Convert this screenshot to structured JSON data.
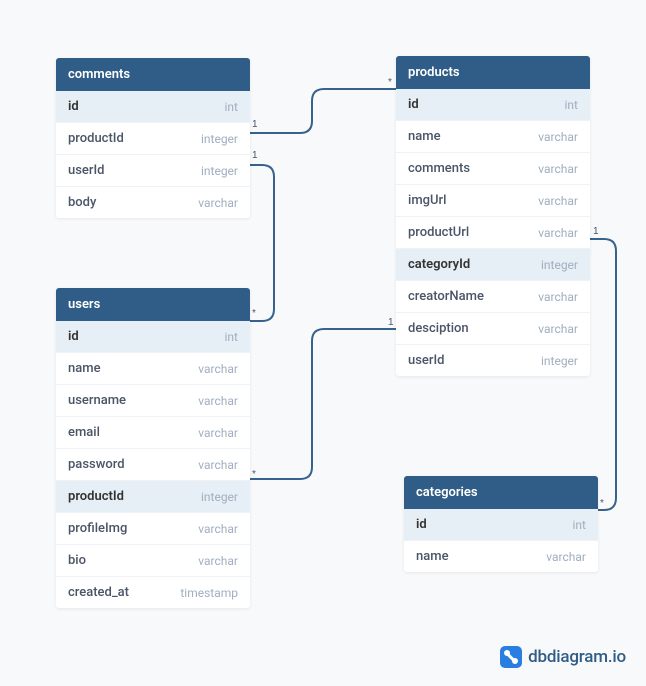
{
  "tables": {
    "comments": {
      "title": "comments",
      "columns": [
        {
          "name": "id",
          "type": "int",
          "highlight": true
        },
        {
          "name": "productId",
          "type": "integer",
          "highlight": false
        },
        {
          "name": "userId",
          "type": "integer",
          "highlight": false
        },
        {
          "name": "body",
          "type": "varchar",
          "highlight": false
        }
      ]
    },
    "products": {
      "title": "products",
      "columns": [
        {
          "name": "id",
          "type": "int",
          "highlight": true
        },
        {
          "name": "name",
          "type": "varchar",
          "highlight": false
        },
        {
          "name": "comments",
          "type": "varchar",
          "highlight": false
        },
        {
          "name": "imgUrl",
          "type": "varchar",
          "highlight": false
        },
        {
          "name": "productUrl",
          "type": "varchar",
          "highlight": false
        },
        {
          "name": "categoryId",
          "type": "integer",
          "highlight": true
        },
        {
          "name": "creatorName",
          "type": "varchar",
          "highlight": false
        },
        {
          "name": "desciption",
          "type": "varchar",
          "highlight": false
        },
        {
          "name": "userId",
          "type": "integer",
          "highlight": false
        }
      ]
    },
    "users": {
      "title": "users",
      "columns": [
        {
          "name": "id",
          "type": "int",
          "highlight": true
        },
        {
          "name": "name",
          "type": "varchar",
          "highlight": false
        },
        {
          "name": "username",
          "type": "varchar",
          "highlight": false
        },
        {
          "name": "email",
          "type": "varchar",
          "highlight": false
        },
        {
          "name": "password",
          "type": "varchar",
          "highlight": false
        },
        {
          "name": "productId",
          "type": "integer",
          "highlight": true
        },
        {
          "name": "profileImg",
          "type": "varchar",
          "highlight": false
        },
        {
          "name": "bio",
          "type": "varchar",
          "highlight": false
        },
        {
          "name": "created_at",
          "type": "timestamp",
          "highlight": false
        }
      ]
    },
    "categories": {
      "title": "categories",
      "columns": [
        {
          "name": "id",
          "type": "int",
          "highlight": true
        },
        {
          "name": "name",
          "type": "varchar",
          "highlight": false
        }
      ]
    }
  },
  "relationships": [
    {
      "from_table": "comments",
      "from_col": "productId",
      "from_card": "1",
      "to_table": "products",
      "to_col": "id",
      "to_card": "*"
    },
    {
      "from_table": "comments",
      "from_col": "userId",
      "from_card": "1",
      "to_table": "users",
      "to_col": "id",
      "to_card": "*"
    },
    {
      "from_table": "users",
      "from_col": "productId",
      "from_card": "*",
      "to_table": "products",
      "to_col": "userId",
      "to_card": "1"
    },
    {
      "from_table": "products",
      "from_col": "categoryId",
      "from_card": "1",
      "to_table": "categories",
      "to_col": "id",
      "to_card": "*"
    }
  ],
  "logo": {
    "text": "dbdiagram.io"
  },
  "chart_data": {
    "type": "table",
    "description": "Entity-relationship diagram with four tables",
    "entities": [
      "comments",
      "products",
      "users",
      "categories"
    ],
    "edges": [
      {
        "from": "comments.productId",
        "to": "products.id",
        "cardinality": "1-*"
      },
      {
        "from": "comments.userId",
        "to": "users.id",
        "cardinality": "1-*"
      },
      {
        "from": "users.productId",
        "to": "products.userId",
        "cardinality": "*-1"
      },
      {
        "from": "products.categoryId",
        "to": "categories.id",
        "cardinality": "1-*"
      }
    ]
  }
}
